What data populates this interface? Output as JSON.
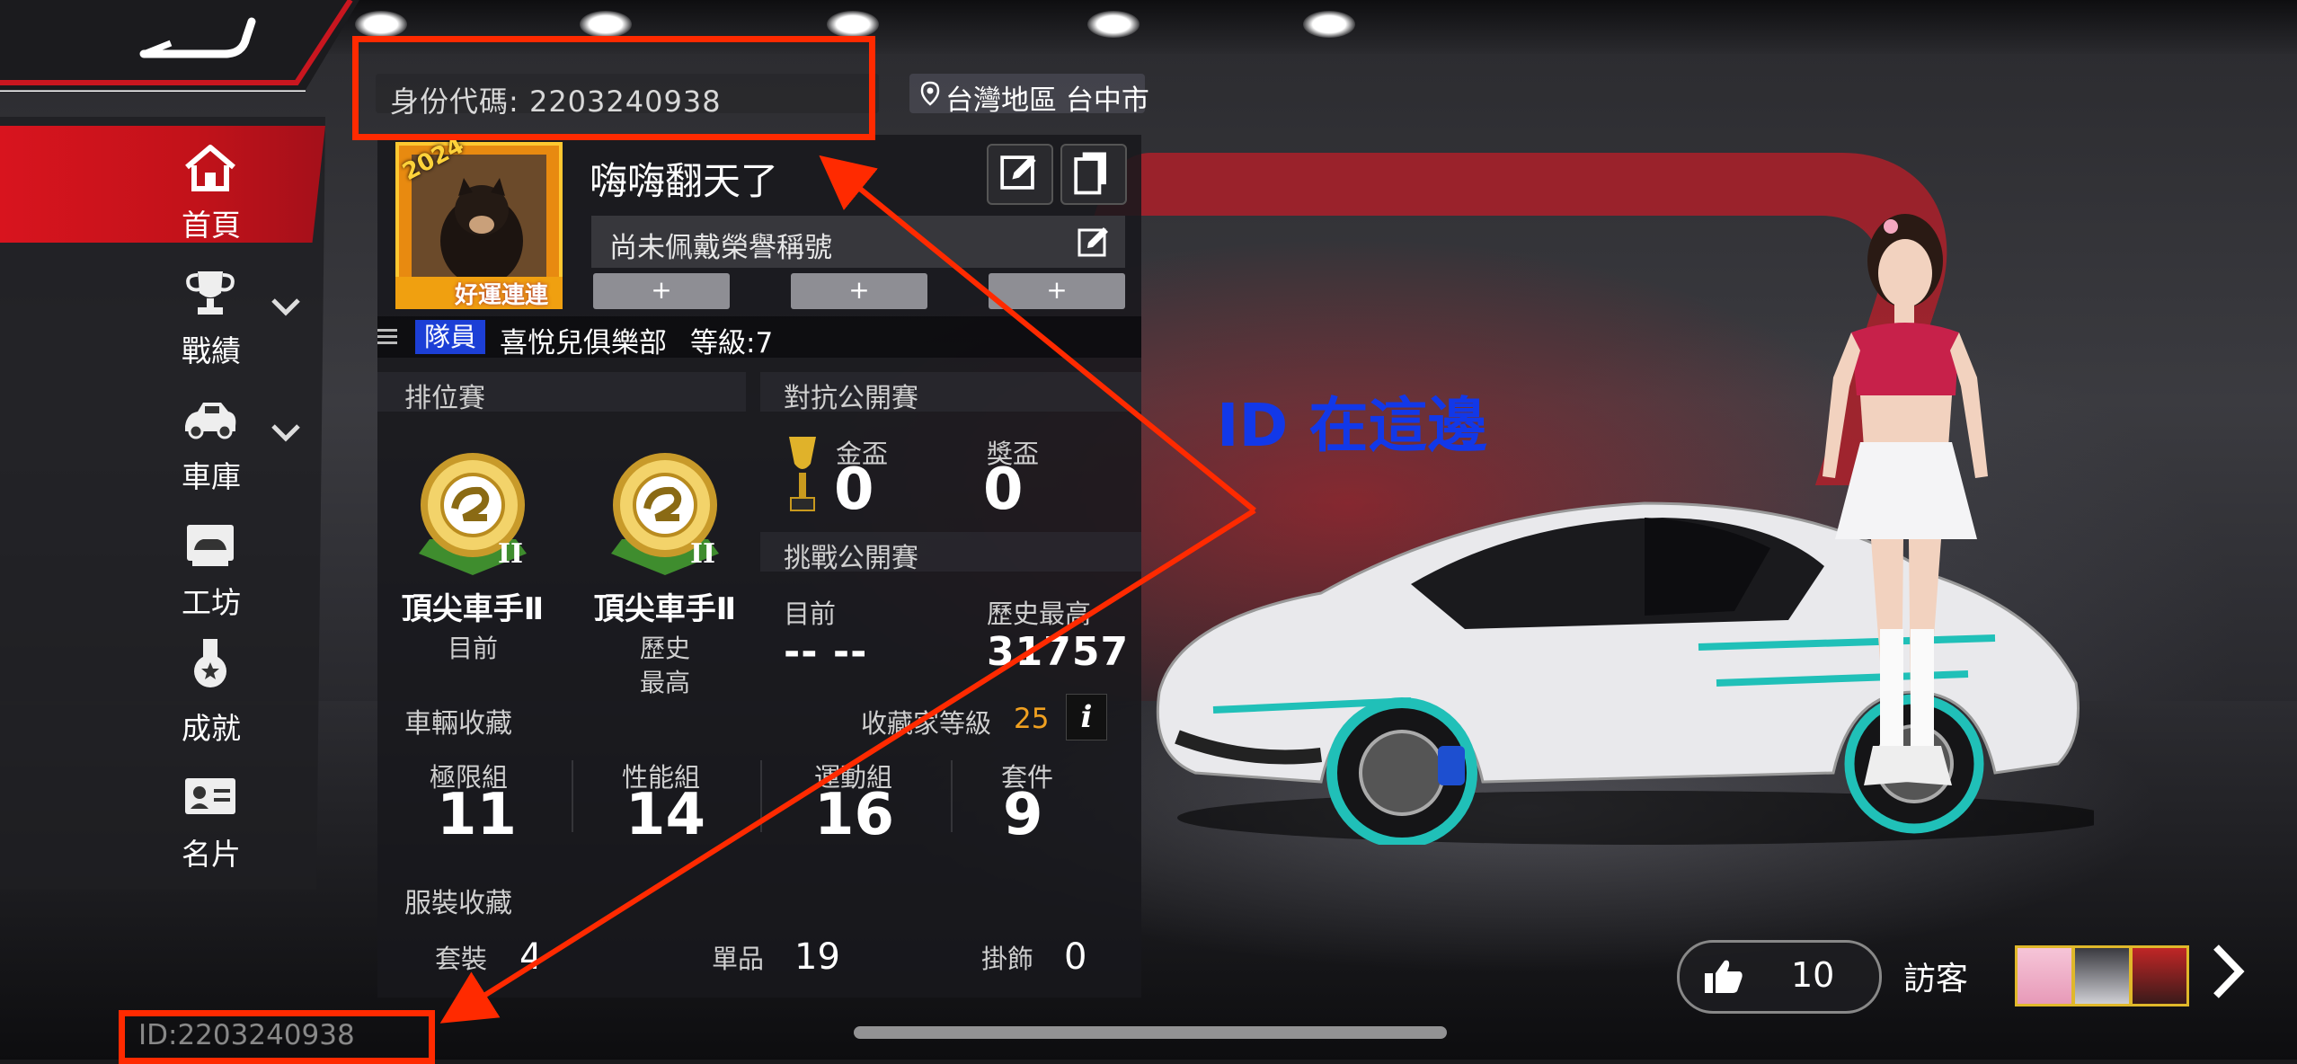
{
  "header": {
    "id_label": "身份代碼: 2203240938",
    "location": "台灣地區 台中市"
  },
  "sidebar": {
    "items": [
      {
        "label": "首頁",
        "icon": "home-icon",
        "active": true
      },
      {
        "label": "戰績",
        "icon": "trophy-icon",
        "expandable": true
      },
      {
        "label": "車庫",
        "icon": "car-icon",
        "expandable": true
      },
      {
        "label": "工坊",
        "icon": "workshop-icon"
      },
      {
        "label": "成就",
        "icon": "medal-icon"
      },
      {
        "label": "名片",
        "icon": "id-card-icon"
      }
    ]
  },
  "profile": {
    "avatar_year": "2024",
    "avatar_caption": "好運連連",
    "name": "嗨嗨翻天了",
    "honor_title": "尚未佩戴榮譽稱號",
    "slots": [
      "+",
      "+",
      "+"
    ],
    "role": "隊員",
    "club": "喜悅兒俱樂部",
    "level": "等級:7"
  },
  "ranked": {
    "heading": "排位賽",
    "current": {
      "rank": "頂尖車手Ⅱ",
      "label": "目前"
    },
    "best": {
      "rank": "頂尖車手Ⅱ",
      "label_line1": "歷史",
      "label_line2": "最高"
    }
  },
  "open_match": {
    "heading": "對抗公開賽",
    "gold_label": "金盃",
    "gold_value": "0",
    "prize_label": "獎盃",
    "prize_value": "0"
  },
  "challenge": {
    "heading": "挑戰公開賽",
    "current_label": "目前",
    "current_value": "-- --",
    "best_label": "歷史最高",
    "best_value": "31757"
  },
  "vehicles": {
    "heading": "車輛收藏",
    "collector_label": "收藏家等級",
    "collector_level": "25",
    "info": "i",
    "groups": [
      {
        "label": "極限組",
        "value": "11"
      },
      {
        "label": "性能組",
        "value": "14"
      },
      {
        "label": "運動組",
        "value": "16"
      },
      {
        "label": "套件",
        "value": "9"
      }
    ]
  },
  "outfits": {
    "heading": "服裝收藏",
    "items": [
      {
        "label": "套裝",
        "value": "4"
      },
      {
        "label": "單品",
        "value": "19"
      },
      {
        "label": "掛飾",
        "value": "0"
      }
    ]
  },
  "social": {
    "likes": "10",
    "visitors_label": "訪客"
  },
  "footer": {
    "id_text": "ID:2203240938"
  },
  "annotation": {
    "text": "ID 在這邊",
    "color": "#1238e8",
    "box_color": "#ff2a00"
  },
  "colors": {
    "accent_red": "#d8141e",
    "role_blue": "#1c3fd6",
    "collector_orange": "#f0a020",
    "gold": "#e0b82a"
  }
}
